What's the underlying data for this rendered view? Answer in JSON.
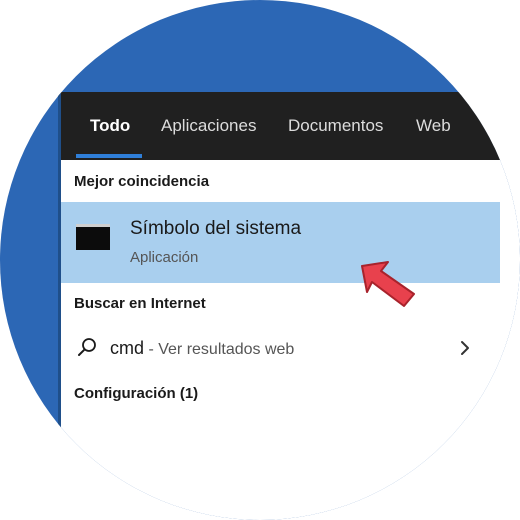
{
  "tabs": [
    {
      "label": "Todo",
      "active": true
    },
    {
      "label": "Aplicaciones",
      "active": false
    },
    {
      "label": "Documentos",
      "active": false
    },
    {
      "label": "Web",
      "active": false
    }
  ],
  "best_match": {
    "section_title": "Mejor coincidencia",
    "title": "Símbolo del sistema",
    "subtitle": "Aplicación",
    "icon": "command-prompt-icon"
  },
  "web_search": {
    "section_title": "Buscar en Internet",
    "query": "cmd",
    "separator": " - ",
    "hint": "Ver resultados web",
    "icon": "search-icon"
  },
  "settings": {
    "section_title": "Configuración (1)"
  },
  "colors": {
    "accent": "#2f7fd9",
    "selected_row": "#a9cfee",
    "tabbar": "#202020",
    "desktop": "#2c67b5",
    "pointer_arrow": "#e8414d"
  }
}
